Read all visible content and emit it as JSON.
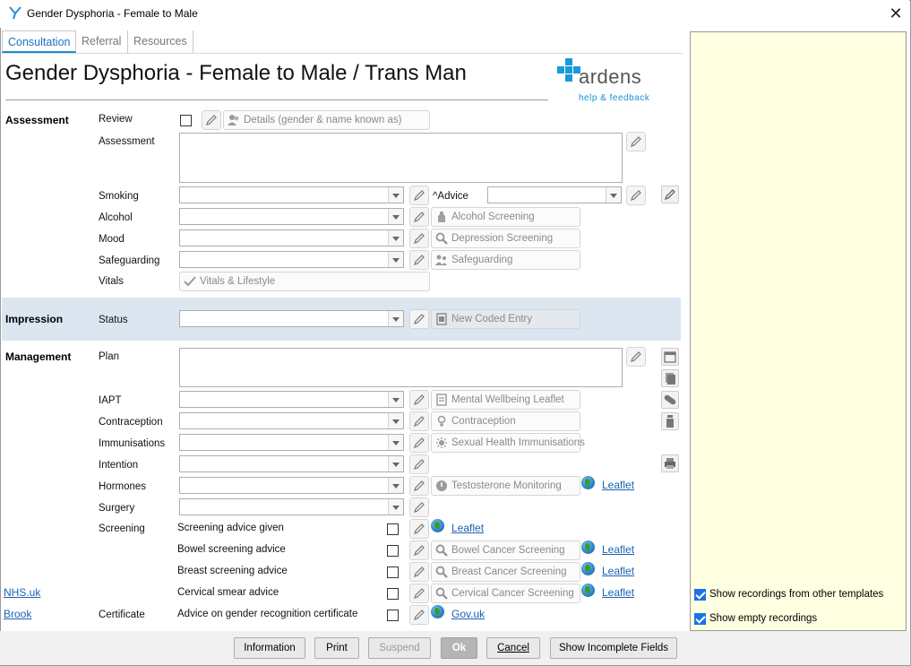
{
  "window": {
    "title": "Gender Dysphoria - Female to Male"
  },
  "tabs": [
    {
      "label": "Consultation"
    },
    {
      "label": "Referral"
    },
    {
      "label": "Resources"
    }
  ],
  "page_title": "Gender Dysphoria - Female to Male / Trans Man",
  "logo": {
    "brand": "ardens",
    "tagline": "help & feedback"
  },
  "sections": {
    "assessment": "Assessment",
    "impression": "Impression",
    "management": "Management"
  },
  "fields": {
    "review": "Review",
    "review_chip": "Details (gender & name known as)",
    "assessment": "Assessment",
    "smoking": "Smoking",
    "advice": "^Advice",
    "alcohol": "Alcohol",
    "alcohol_chip": "Alcohol Screening",
    "mood": "Mood",
    "mood_chip": "Depression Screening",
    "safeguarding": "Safeguarding",
    "safeguarding_chip": "Safeguarding",
    "vitals": "Vitals",
    "vitals_chip": "Vitals & Lifestyle",
    "status": "Status",
    "status_chip": "New Coded Entry",
    "plan": "Plan",
    "iapt": "IAPT",
    "iapt_chip": "Mental Wellbeing Leaflet",
    "contraception": "Contraception",
    "contraception_chip": "Contraception",
    "immunisations": "Immunisations",
    "immunisations_chip": "Sexual Health Immunisations",
    "intention": "Intention",
    "hormones": "Hormones",
    "hormones_chip": "Testosterone Monitoring",
    "hormones_link": "Leaflet",
    "surgery": "Surgery",
    "screening": "Screening",
    "certificate": "Certificate"
  },
  "screening_rows": [
    {
      "label": "Screening advice given",
      "chip": "",
      "link": "Leaflet"
    },
    {
      "label": "Bowel screening advice",
      "chip": "Bowel Cancer Screening",
      "link": "Leaflet"
    },
    {
      "label": "Breast screening advice",
      "chip": "Breast Cancer Screening",
      "link": "Leaflet"
    },
    {
      "label": "Cervical smear advice",
      "chip": "Cervical Cancer Screening",
      "link": "Leaflet"
    },
    {
      "label": "Advice on gender recognition certificate",
      "chip": "",
      "link": "Gov.uk"
    }
  ],
  "left_links": {
    "nhs": "NHS.uk",
    "brook": "Brook"
  },
  "right_panel": {
    "options": [
      {
        "label": "Show recordings from other templates",
        "checked": true
      },
      {
        "label": "Show empty recordings",
        "checked": true
      }
    ]
  },
  "buttons": {
    "information": "Information",
    "print": "Print",
    "suspend": "Suspend",
    "ok": "Ok",
    "cancel": "Cancel",
    "show_incomplete": "Show Incomplete Fields"
  },
  "colors": {
    "accent": "#1a8fd6",
    "impression_band": "#dce6f1",
    "notes_panel": "#ffffe1",
    "link": "#1a63b0"
  }
}
